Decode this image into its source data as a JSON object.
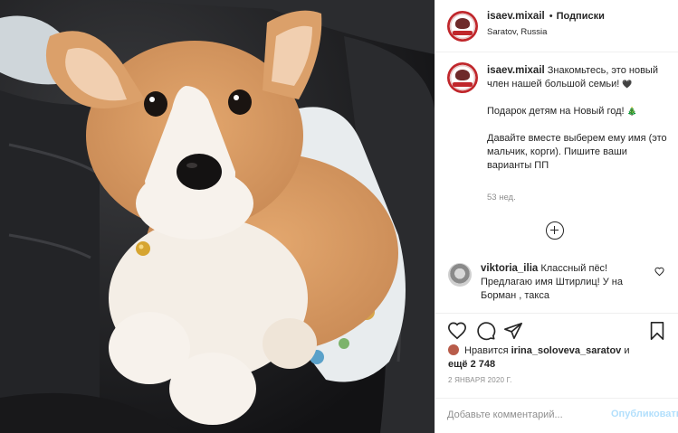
{
  "post": {
    "username": "isaev.mixail",
    "follow_label": "Подписки",
    "location": "Saratov, Russia",
    "caption_username": "isaev.mixail",
    "caption_line1": "Знакомьтесь, это новый член нашей большой семьи!",
    "caption_line2": "Подарок детям на Новый год!",
    "caption_line3": "Давайте вместе выберем ему имя (это мальчик, корги). Пишите ваши варианты ПП",
    "time_ago": "53 нед.",
    "comment_username": "viktoria_ilia",
    "comment_text": "Классный пёс! Предлагаю имя Штирлиц! У на Борман , такса",
    "likes_prefix": "Нравится",
    "likes_user": "irina_solovevа_saratov",
    "likes_mid": "и",
    "likes_rest": "ещё 2 748",
    "date": "2 ЯНВАРЯ 2020 Г.",
    "comment_placeholder": "Добавьте комментарий...",
    "publish_label": "Опубликовать"
  },
  "icons": {
    "like": "heart-icon",
    "comment": "comment-icon",
    "share": "paper-plane-icon",
    "save": "bookmark-icon",
    "more": "plus-circle-icon",
    "caption_emoji": "heart-emoji",
    "caption_emoji2": "tree-emoji"
  },
  "colors": {
    "publish_disabled": "#b2dffc",
    "secondary_text": "#8e8e8e",
    "border": "#efefef",
    "avatar_ring": "#c0262b"
  }
}
